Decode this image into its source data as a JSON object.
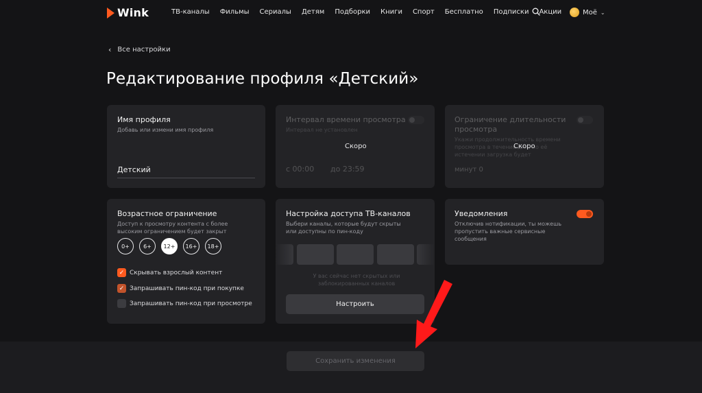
{
  "header": {
    "brand": "Wink",
    "nav": [
      "ТВ-каналы",
      "Фильмы",
      "Сериалы",
      "Детям",
      "Подборки",
      "Книги",
      "Спорт",
      "Бесплатно",
      "Подписки",
      "Акции"
    ],
    "search_icon": "search-icon",
    "user_label": "Моё"
  },
  "breadcrumb": {
    "back_label": "Все настройки"
  },
  "page_title": "Редактирование профиля «Детский»",
  "cards": {
    "profile_name": {
      "title": "Имя профиля",
      "subtitle": "Добавь или измени имя профиля",
      "value": "Детский"
    },
    "watch_interval": {
      "title": "Интервал времени просмотра",
      "subtitle": "Интервал не установлен",
      "soon": "Скоро",
      "from": "с  00:00",
      "to": "до  23:59"
    },
    "duration_limit": {
      "title": "Ограничение длительности просмотра",
      "subtitle": "Укажи продолжительность времени просмотра в течение дня, по её истечении загрузка будет",
      "soon": "Скоро",
      "minutes": "минут  0"
    },
    "age_limit": {
      "title": "Возрастное ограничение",
      "subtitle": "Доступ к просмотру контента с более высоким ограничением будет закрыт",
      "ages": [
        "0+",
        "6+",
        "12+",
        "16+",
        "18+"
      ],
      "selected": "12+",
      "checks": [
        {
          "label": "Скрывать взрослый контент",
          "checked": true
        },
        {
          "label": "Запрашивать пин-код при покупке",
          "checked": true
        },
        {
          "label": "Запрашивать пин-код при просмотре",
          "checked": false
        }
      ]
    },
    "tv_access": {
      "title": "Настройка доступа ТВ-каналов",
      "subtitle": "Выбери каналы, которые будут скрыты или доступны по пин-коду",
      "empty_note": "У вас сейчас нет скрытых или заблокированных каналов",
      "button": "Настроить"
    },
    "notifications": {
      "title": "Уведомления",
      "subtitle": "Отключив нотификации, ты можешь пропустить важные сервисные сообщения",
      "enabled": true
    }
  },
  "footer": {
    "save_label": "Сохранить изменения"
  },
  "colors": {
    "accent": "#ff5a1f",
    "background": "#141416",
    "card": "#232326"
  }
}
